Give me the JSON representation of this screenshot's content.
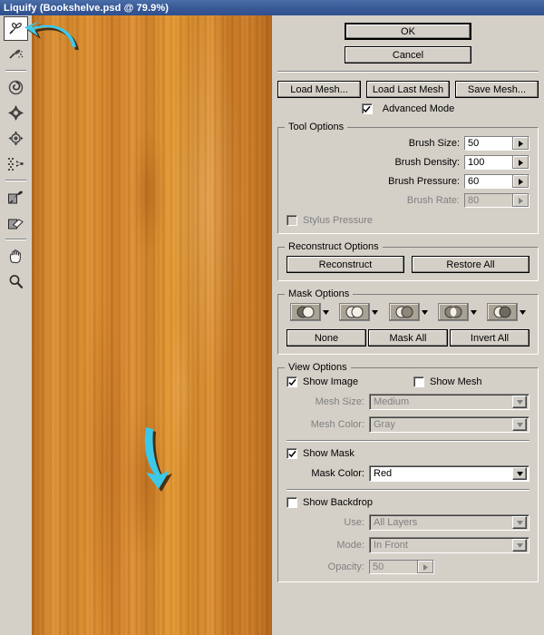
{
  "window": {
    "title": "Liquify (Bookshelve.psd @ 79.9%)"
  },
  "toolbar": {
    "tools": [
      {
        "name": "forward-warp-tool",
        "label": "Forward Warp Tool",
        "selected": true
      },
      {
        "name": "reconstruct-tool",
        "label": "Reconstruct Tool",
        "selected": false
      },
      {
        "name": "twirl-clockwise-tool",
        "label": "Twirl Clockwise Tool",
        "selected": false
      },
      {
        "name": "pucker-tool",
        "label": "Pucker Tool",
        "selected": false
      },
      {
        "name": "bloat-tool",
        "label": "Bloat Tool",
        "selected": false
      },
      {
        "name": "push-left-tool",
        "label": "Push Left Tool",
        "selected": false
      },
      {
        "name": "freeze-mask-tool",
        "label": "Freeze Mask Tool",
        "selected": false
      },
      {
        "name": "thaw-mask-tool",
        "label": "Thaw Mask Tool",
        "selected": false
      },
      {
        "name": "hand-tool",
        "label": "Hand Tool",
        "selected": false
      },
      {
        "name": "zoom-tool",
        "label": "Zoom Tool",
        "selected": false
      }
    ]
  },
  "canvas": {
    "document_name": "Bookshelve.psd",
    "zoom": "79.9%",
    "wood_color": "#d9862a"
  },
  "annotations": {
    "arrow_color": "#3ec8e8",
    "arrows": [
      {
        "name": "arrow-toolbar",
        "points_to": "forward-warp-tool"
      },
      {
        "name": "arrow-brush-density",
        "points_to": "brush-density-field"
      },
      {
        "name": "arrow-canvas",
        "points_to": "image-canvas"
      }
    ]
  },
  "actions": {
    "ok": "OK",
    "cancel": "Cancel",
    "load_mesh": "Load Mesh...",
    "load_last_mesh": "Load Last Mesh",
    "save_mesh": "Save Mesh...",
    "advanced_mode": "Advanced Mode",
    "advanced_mode_checked": true
  },
  "tool_options": {
    "title": "Tool Options",
    "fields": [
      {
        "name": "brush-size",
        "label": "Brush Size:",
        "value": "50",
        "disabled": false
      },
      {
        "name": "brush-density",
        "label": "Brush Density:",
        "value": "100",
        "disabled": false
      },
      {
        "name": "brush-pressure",
        "label": "Brush Pressure:",
        "value": "60",
        "disabled": false
      },
      {
        "name": "brush-rate",
        "label": "Brush Rate:",
        "value": "80",
        "disabled": true
      }
    ],
    "stylus_pressure": "Stylus Pressure",
    "stylus_pressure_checked": false,
    "stylus_pressure_disabled": true
  },
  "reconstruct_options": {
    "title": "Reconstruct Options",
    "reconstruct": "Reconstruct",
    "restore_all": "Restore All"
  },
  "mask_options": {
    "title": "Mask Options",
    "modes": [
      {
        "name": "mask-mode-replace-selection",
        "label": "Replace Selection"
      },
      {
        "name": "mask-mode-add-to-selection",
        "label": "Add To Selection"
      },
      {
        "name": "mask-mode-subtract-from-selection",
        "label": "Subtract From Selection"
      },
      {
        "name": "mask-mode-intersect-with-selection",
        "label": "Intersect With Selection"
      },
      {
        "name": "mask-mode-invert-selection",
        "label": "Invert Selection"
      }
    ],
    "none": "None",
    "mask_all": "Mask All",
    "invert_all": "Invert All"
  },
  "view_options": {
    "title": "View Options",
    "show_image": "Show Image",
    "show_image_checked": true,
    "show_mesh": "Show Mesh",
    "show_mesh_checked": false,
    "mesh_size_label": "Mesh Size:",
    "mesh_size_value": "Medium",
    "mesh_size_disabled": true,
    "mesh_color_label": "Mesh Color:",
    "mesh_color_value": "Gray",
    "mesh_color_disabled": true,
    "show_mask": "Show Mask",
    "show_mask_checked": true,
    "mask_color_label": "Mask Color:",
    "mask_color_value": "Red",
    "mask_color_disabled": false,
    "show_backdrop": "Show Backdrop",
    "show_backdrop_checked": false,
    "use_label": "Use:",
    "use_value": "All Layers",
    "use_disabled": true,
    "mode_label": "Mode:",
    "mode_value": "In Front",
    "mode_disabled": true,
    "opacity_label": "Opacity:",
    "opacity_value": "50",
    "opacity_disabled": true
  }
}
